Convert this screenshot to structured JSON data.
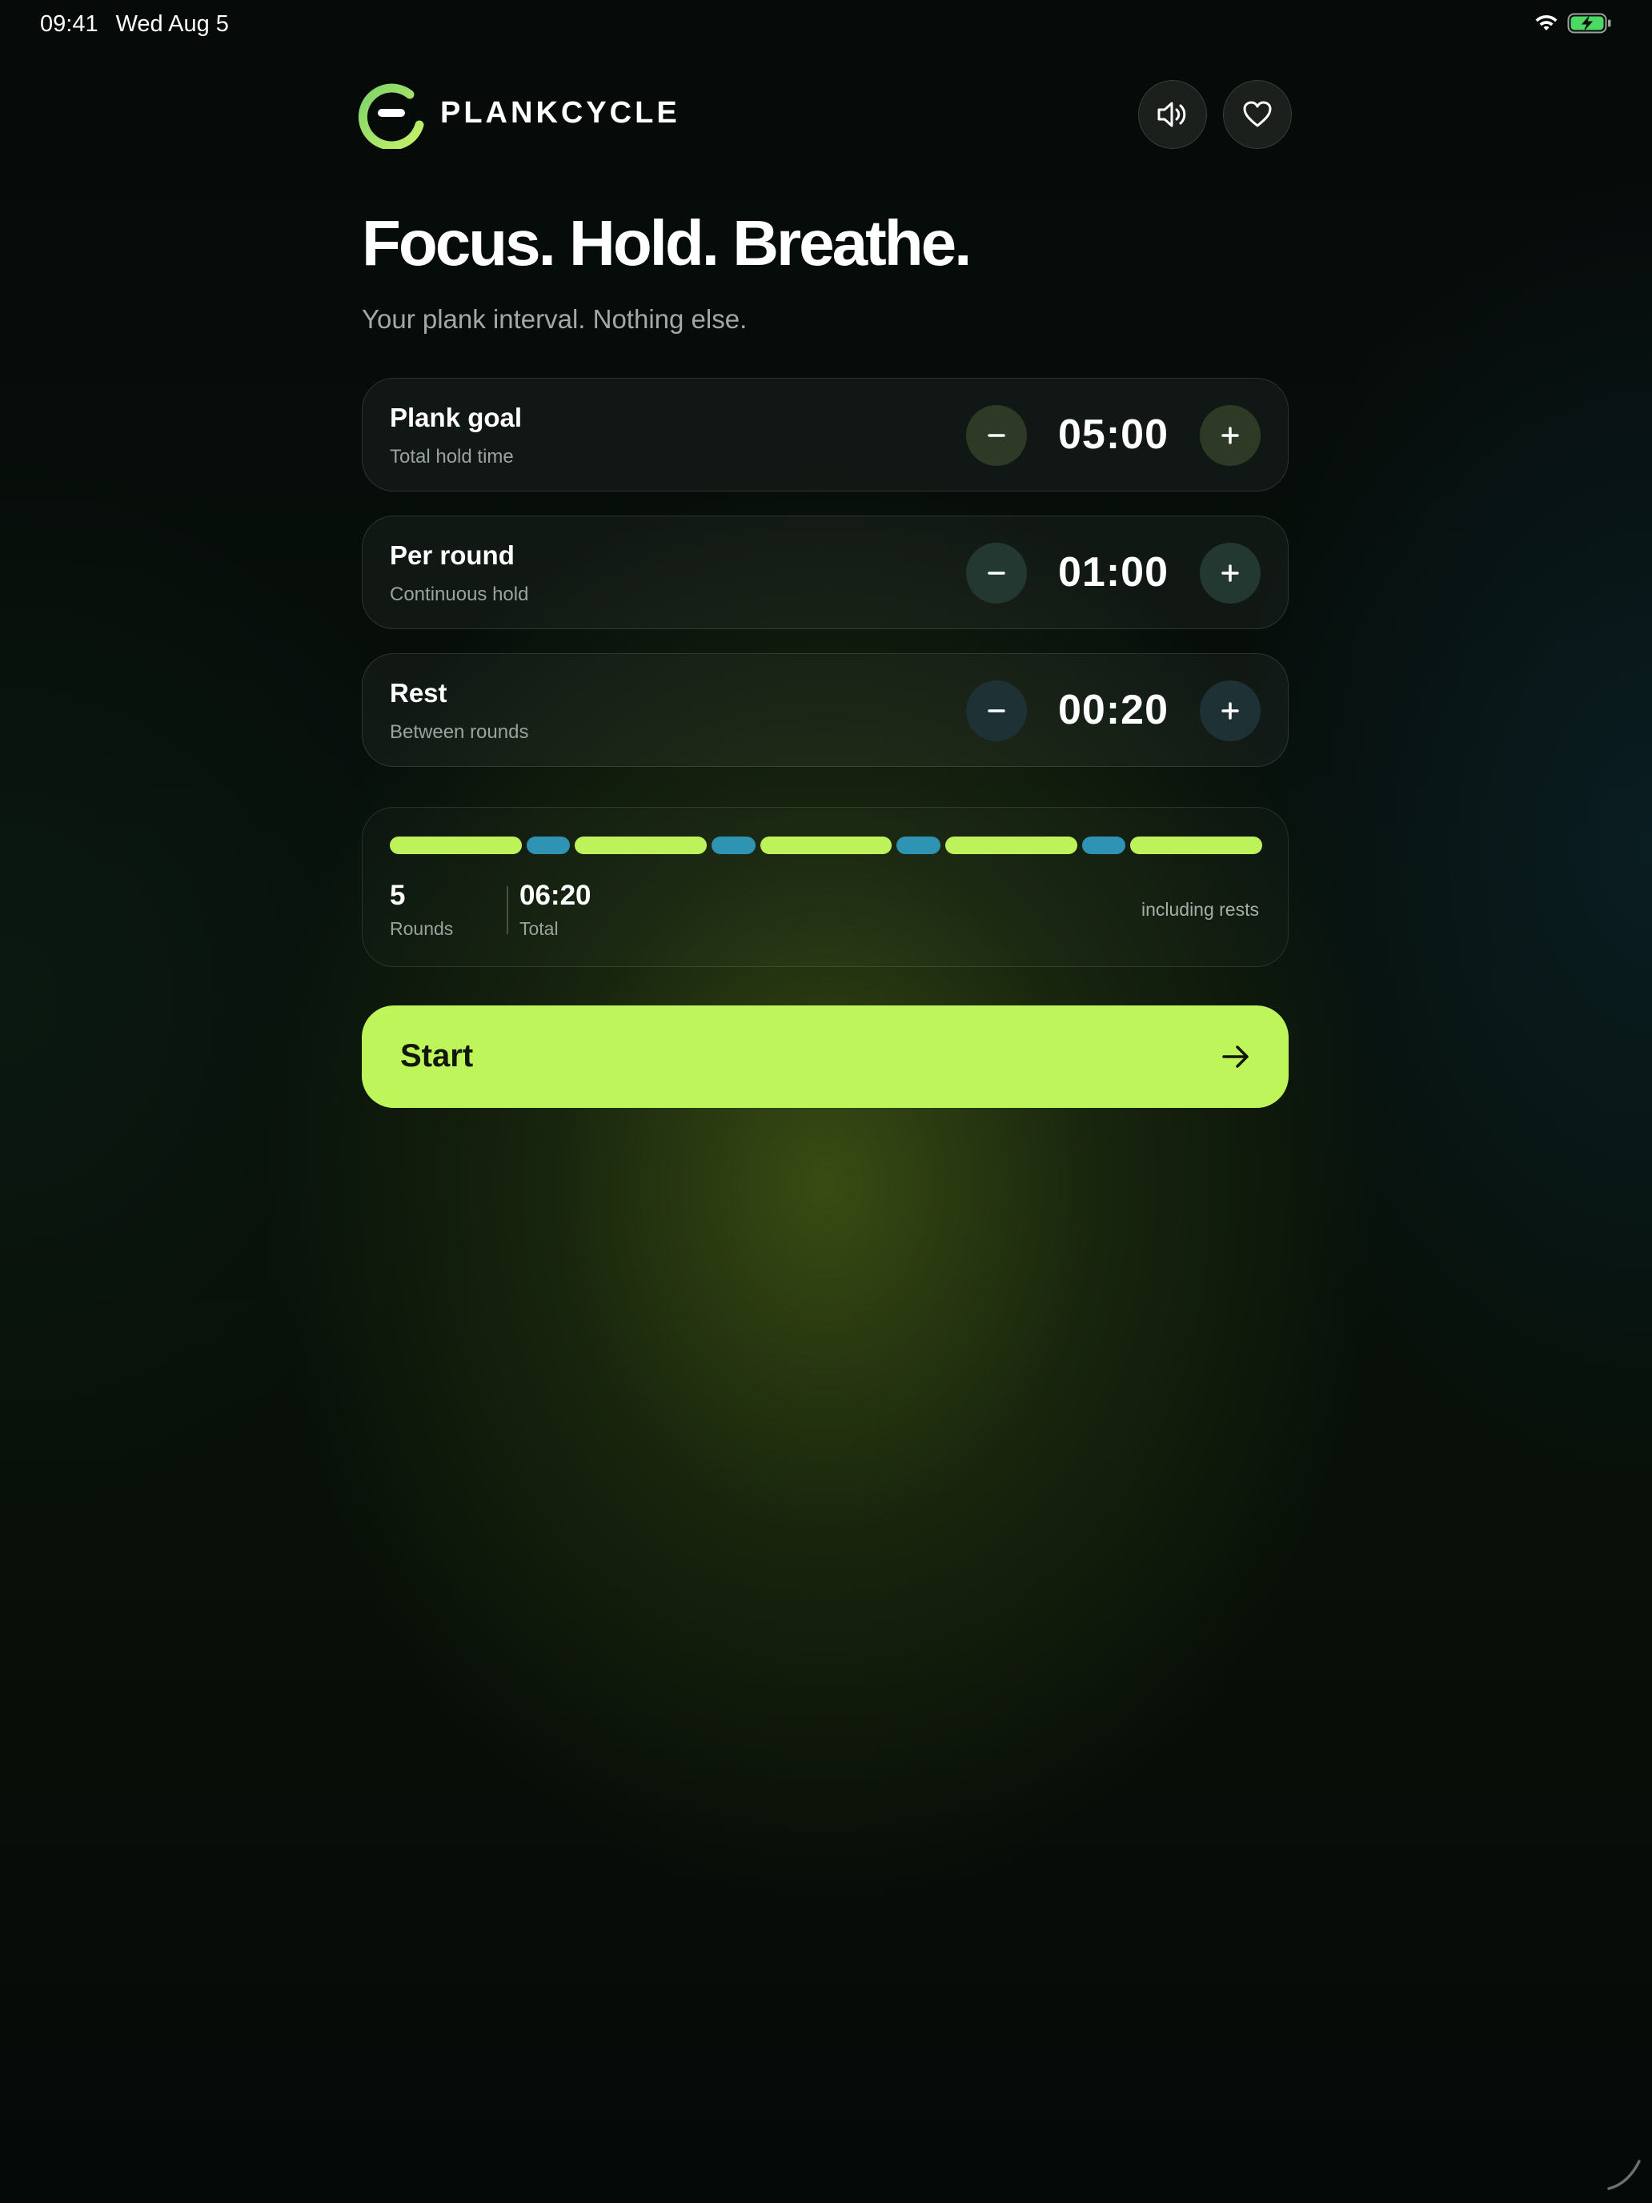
{
  "status_bar": {
    "time": "09:41",
    "date": "Wed Aug 5"
  },
  "header": {
    "brand": "PLANKCYCLE"
  },
  "hero": {
    "headline": "Focus. Hold. Breathe.",
    "subtitle": "Your plank interval. Nothing else."
  },
  "settings": [
    {
      "title": "Plank goal",
      "description": "Total hold time",
      "value": "05:00"
    },
    {
      "title": "Per round",
      "description": "Continuous hold",
      "value": "01:00"
    },
    {
      "title": "Rest",
      "description": "Between rounds",
      "value": "00:20"
    }
  ],
  "summary": {
    "rounds_value": "5",
    "rounds_label": "Rounds",
    "total_value": "06:20",
    "total_label": "Total",
    "note": "including rests",
    "segments": [
      "work",
      "rest",
      "work",
      "rest",
      "work",
      "rest",
      "work",
      "rest",
      "work"
    ]
  },
  "start_button": {
    "label": "Start"
  },
  "colors": {
    "accent": "#bdf55a",
    "rest": "#2f93b3",
    "background": "#070d0a"
  },
  "icons": [
    "wifi-icon",
    "battery-icon",
    "logo-icon",
    "speaker-icon",
    "heart-icon",
    "minus-icon",
    "plus-icon",
    "arrow-right-icon"
  ]
}
